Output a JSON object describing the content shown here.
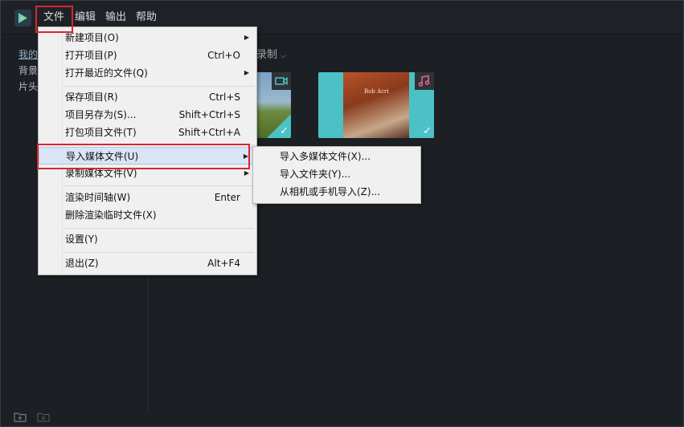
{
  "menubar": {
    "items": [
      {
        "key": "file",
        "label": "文件"
      },
      {
        "key": "edit",
        "label": "编辑"
      },
      {
        "key": "export",
        "label": "输出"
      },
      {
        "key": "help",
        "label": "帮助"
      }
    ]
  },
  "sidebar": {
    "items": [
      {
        "label": "我的",
        "active": true
      },
      {
        "label": "背景"
      },
      {
        "label": "片头"
      }
    ]
  },
  "toolbar": {
    "record_label": "录制"
  },
  "media": {
    "thumbnails": [
      {
        "type": "video-icon",
        "selected": true
      },
      {
        "type": "music-icon",
        "selected": true,
        "cover_text": "Bob Acri"
      }
    ]
  },
  "file_menu": {
    "items": [
      {
        "label": "新建项目(O)",
        "shortcut": "",
        "submenu": true
      },
      {
        "label": "打开项目(P)",
        "shortcut": "Ctrl+O",
        "submenu": false
      },
      {
        "label": "打开最近的文件(Q)",
        "shortcut": "",
        "submenu": true
      },
      {
        "label": "保存项目(R)",
        "shortcut": "Ctrl+S",
        "submenu": false
      },
      {
        "label": "项目另存为(S)...",
        "shortcut": "Shift+Ctrl+S",
        "submenu": false
      },
      {
        "label": "打包项目文件(T)",
        "shortcut": "Shift+Ctrl+A",
        "submenu": false
      },
      {
        "label": "导入媒体文件(U)",
        "shortcut": "",
        "submenu": true,
        "highlighted": true
      },
      {
        "label": "录制媒体文件(V)",
        "shortcut": "",
        "submenu": true
      },
      {
        "label": "渲染时间轴(W)",
        "shortcut": "Enter",
        "submenu": false
      },
      {
        "label": "删除渲染临时文件(X)",
        "shortcut": "",
        "submenu": false
      },
      {
        "label": "设置(Y)",
        "shortcut": "",
        "submenu": false
      },
      {
        "label": "退出(Z)",
        "shortcut": "Alt+F4",
        "submenu": false
      }
    ]
  },
  "import_submenu": {
    "items": [
      {
        "label": "导入多媒体文件(X)..."
      },
      {
        "label": "导入文件夹(Y)..."
      },
      {
        "label": "从相机或手机导入(Z)..."
      }
    ]
  },
  "colors": {
    "background": "#1c1f24",
    "highlight_box": "#d9262f",
    "check_accent": "#4cc2c6",
    "music_icon": "#e36a8a",
    "video_icon": "#4cc2c6"
  }
}
